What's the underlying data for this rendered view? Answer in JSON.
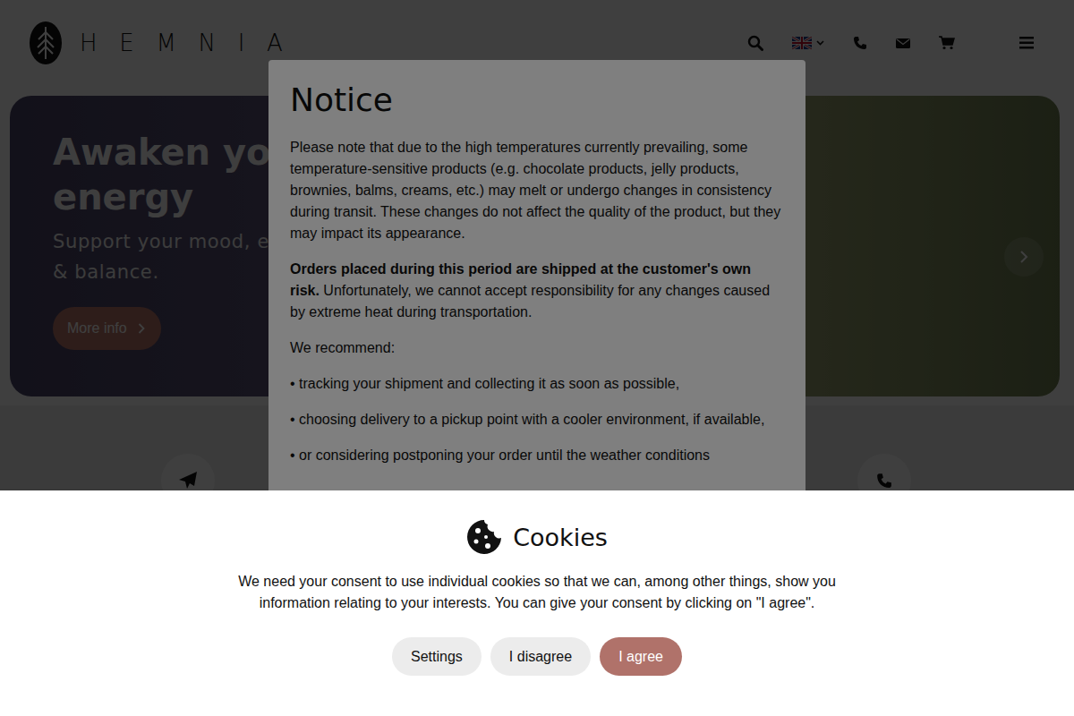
{
  "header": {
    "logo": "HEMNIA"
  },
  "hero": {
    "title_lines": [
      "Awaken you",
      "energy"
    ],
    "subtitle_lines": [
      "Support your mood, en",
      "& balance."
    ],
    "button": "More info"
  },
  "notice": {
    "title": "Notice",
    "paragraphs": [
      [
        {
          "text": "Please note that due to the high temperatures currently prevailing, some temperature-sensitive products (e.g. chocolate products, jelly products, brownies, balms, creams, etc.) may melt or undergo changes in consistency during transit. These changes do not affect the quality of the product, but they may impact its appearance.",
          "bold": false
        }
      ],
      [
        {
          "text": "Orders placed during this period are shipped at the customer's own risk.",
          "bold": true
        },
        {
          "text": " Unfortunately, we cannot accept responsibility for any changes caused by extreme heat during transportation.",
          "bold": false
        }
      ],
      [
        {
          "text": "We recommend:",
          "bold": false
        }
      ],
      [
        {
          "text": "• tracking your shipment and collecting it as soon as possible,",
          "bold": false
        }
      ],
      [
        {
          "text": "• choosing delivery to a pickup point with a cooler environment, if available,",
          "bold": false
        }
      ],
      [
        {
          "text": "• or considering postponing your order until the weather conditions",
          "bold": false
        }
      ]
    ]
  },
  "cookies": {
    "title": "Cookies",
    "text": "We need your consent to use individual cookies so that we can, among other things, show you information relating to your interests. You can give your consent by clicking on \"I agree\".",
    "buttons": [
      {
        "label": "Settings",
        "primary": false
      },
      {
        "label": "I disagree",
        "primary": false
      },
      {
        "label": "I agree",
        "primary": true
      }
    ]
  }
}
